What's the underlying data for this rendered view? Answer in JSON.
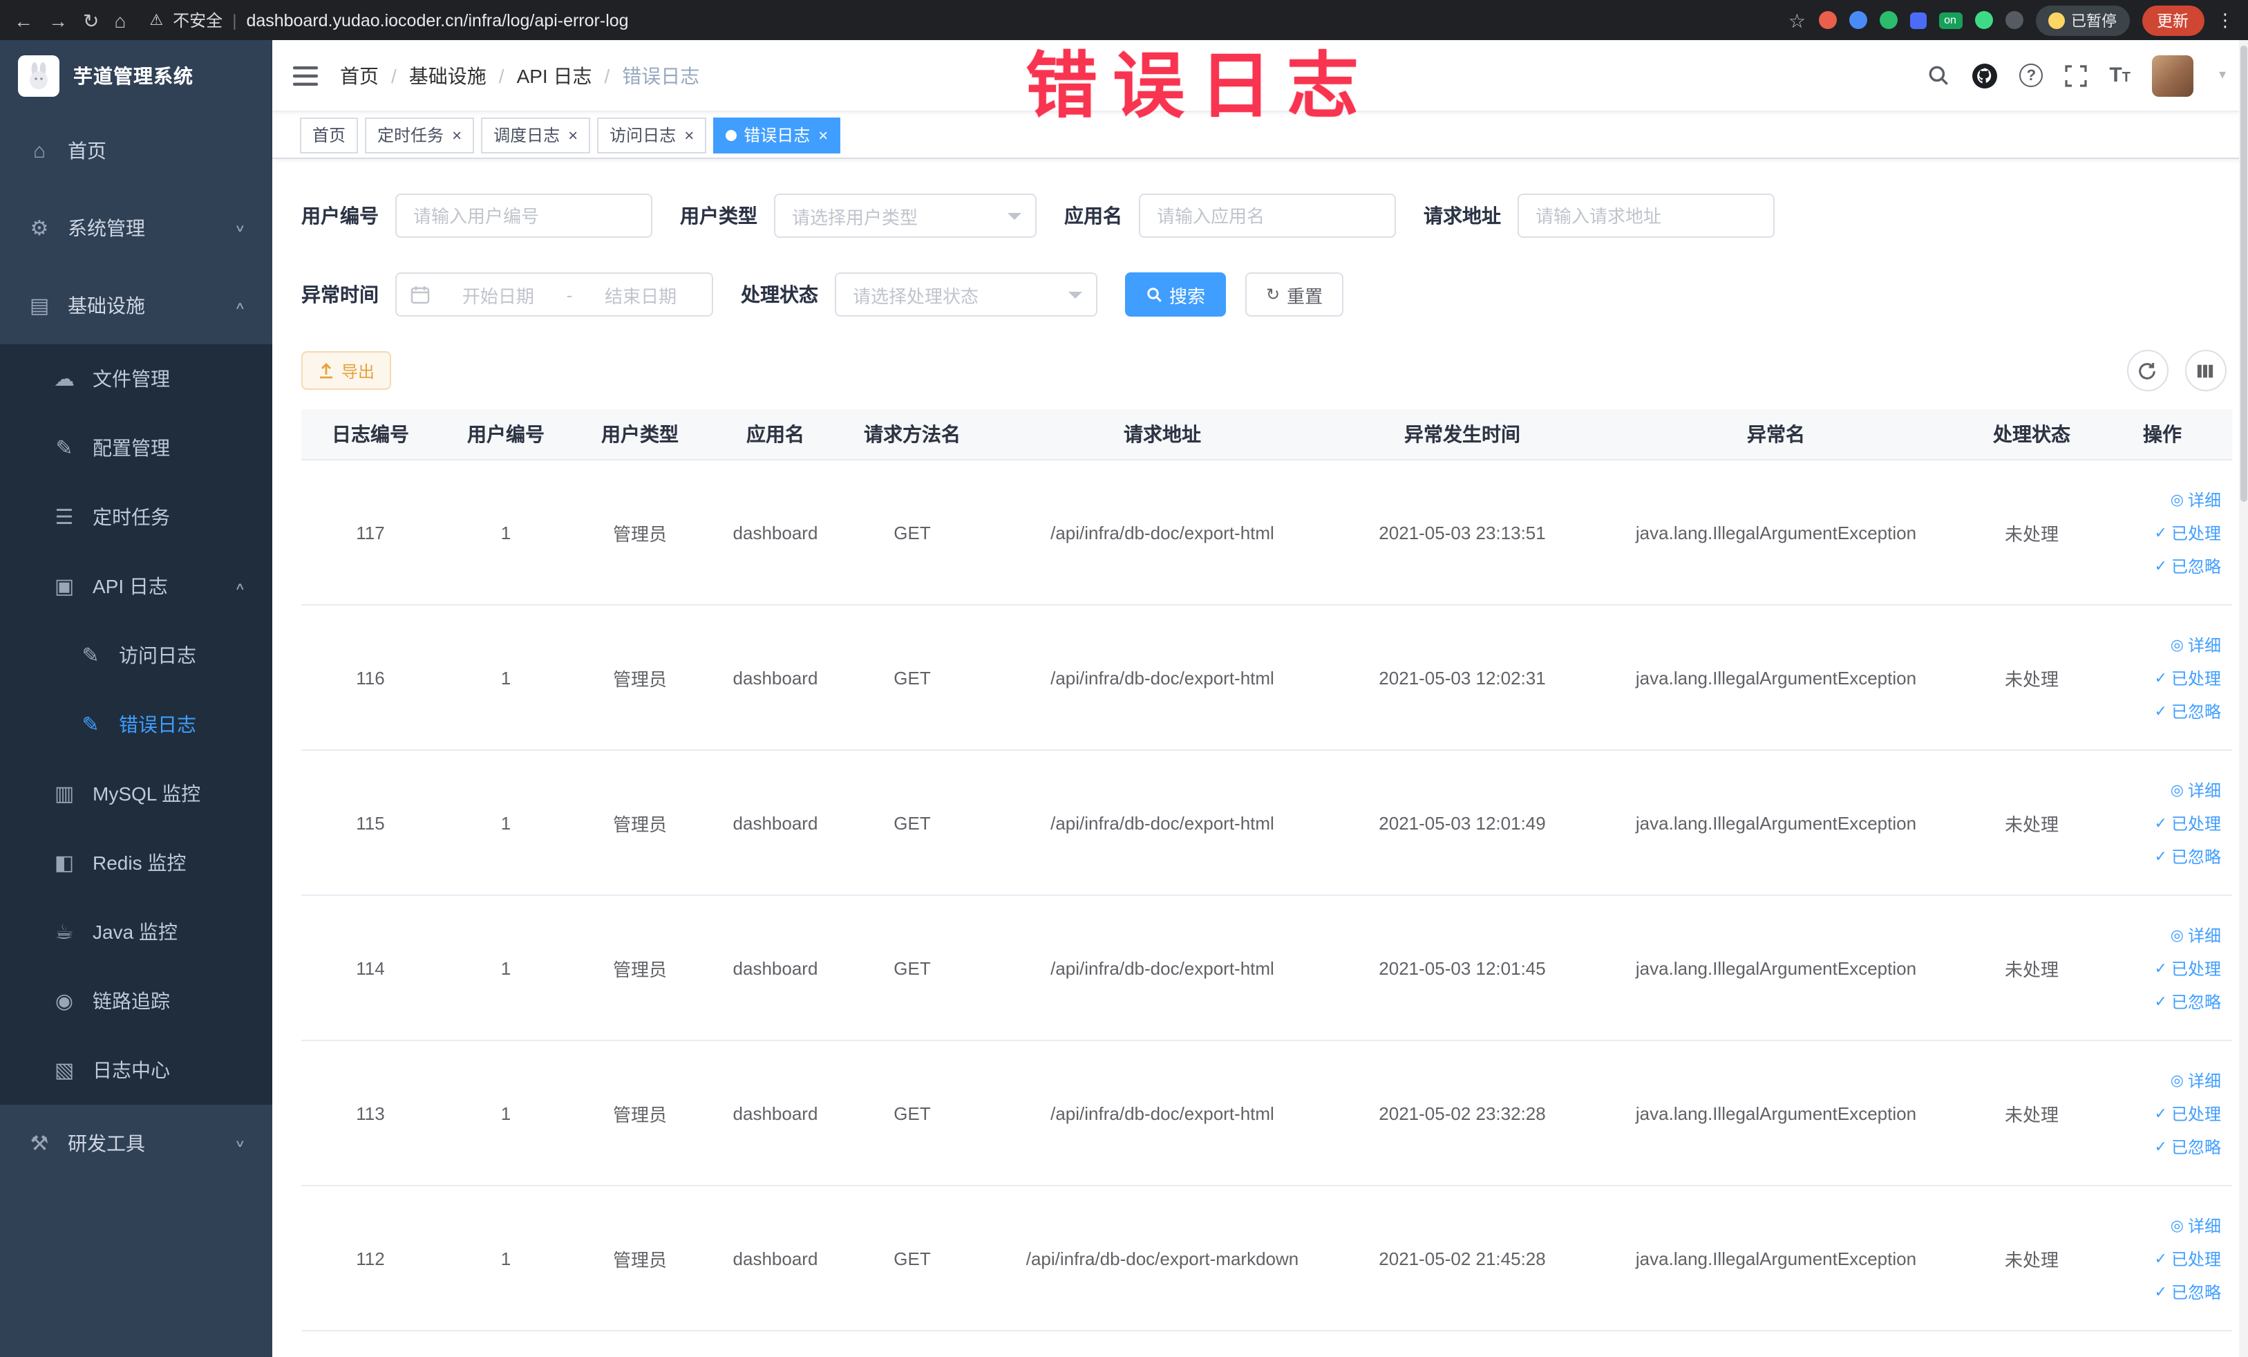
{
  "overlay": {
    "title": "错误日志"
  },
  "browser": {
    "security_label": "不安全",
    "url": "dashboard.yudao.iocoder.cn/infra/log/api-error-log",
    "paused_label": "已暂停",
    "update_label": "更新"
  },
  "icons": {
    "back": "←",
    "forward": "→",
    "reload": "↻",
    "home": "⌂",
    "star": "☆",
    "warning": "⚠",
    "more": "⋮",
    "close": "×",
    "slash": "/",
    "detail": "◎",
    "check": "✓",
    "caret": "▾",
    "reset": "↻"
  },
  "sidebar": {
    "app_title": "芋道管理系统",
    "items": [
      {
        "label": "首页",
        "glyph": "⌂"
      },
      {
        "label": "系统管理",
        "glyph": "⚙",
        "chevron": "∨"
      },
      {
        "label": "基础设施",
        "glyph": "▤",
        "chevron": "∧"
      },
      {
        "label": "文件管理",
        "glyph": "☁"
      },
      {
        "label": "配置管理",
        "glyph": "✎"
      },
      {
        "label": "定时任务",
        "glyph": "☰"
      },
      {
        "label": "API 日志",
        "glyph": "▣",
        "chevron": "∧"
      },
      {
        "label": "访问日志",
        "glyph": "✎"
      },
      {
        "label": "错误日志",
        "glyph": "✎"
      },
      {
        "label": "MySQL 监控",
        "glyph": "▥"
      },
      {
        "label": "Redis 监控",
        "glyph": "◧"
      },
      {
        "label": "Java 监控",
        "glyph": "☕"
      },
      {
        "label": "链路追踪",
        "glyph": "◉"
      },
      {
        "label": "日志中心",
        "glyph": "▧"
      },
      {
        "label": "研发工具",
        "glyph": "⚒",
        "chevron": "∨"
      }
    ]
  },
  "breadcrumb": [
    "首页",
    "基础设施",
    "API 日志",
    "错误日志"
  ],
  "tabs": [
    {
      "label": "首页"
    },
    {
      "label": "定时任务"
    },
    {
      "label": "调度日志"
    },
    {
      "label": "访问日志"
    },
    {
      "label": "错误日志"
    }
  ],
  "filters": {
    "user_id": {
      "label": "用户编号",
      "placeholder": "请输入用户编号"
    },
    "user_type": {
      "label": "用户类型",
      "placeholder": "请选择用户类型"
    },
    "app_name": {
      "label": "应用名",
      "placeholder": "请输入应用名"
    },
    "request_url": {
      "label": "请求地址",
      "placeholder": "请输入请求地址"
    },
    "exception_time": {
      "label": "异常时间",
      "start_placeholder": "开始日期",
      "separator": "-",
      "end_placeholder": "结束日期"
    },
    "process_status": {
      "label": "处理状态",
      "placeholder": "请选择处理状态"
    },
    "search_label": "搜索",
    "reset_label": "重置"
  },
  "toolbar": {
    "export_label": "导出"
  },
  "table": {
    "columns": [
      "日志编号",
      "用户编号",
      "用户类型",
      "应用名",
      "请求方法名",
      "请求地址",
      "异常发生时间",
      "异常名",
      "处理状态",
      "操作"
    ],
    "actions": {
      "detail": "详细",
      "processed": "已处理",
      "ignored": "已忽略"
    },
    "rows": [
      {
        "id": "117",
        "user_id": "1",
        "user_type": "管理员",
        "app": "dashboard",
        "method": "GET",
        "url": "/api/infra/db-doc/export-html",
        "time": "2021-05-03 23:13:51",
        "exception": "java.lang.IllegalArgumentException",
        "status": "未处理"
      },
      {
        "id": "116",
        "user_id": "1",
        "user_type": "管理员",
        "app": "dashboard",
        "method": "GET",
        "url": "/api/infra/db-doc/export-html",
        "time": "2021-05-03 12:02:31",
        "exception": "java.lang.IllegalArgumentException",
        "status": "未处理"
      },
      {
        "id": "115",
        "user_id": "1",
        "user_type": "管理员",
        "app": "dashboard",
        "method": "GET",
        "url": "/api/infra/db-doc/export-html",
        "time": "2021-05-03 12:01:49",
        "exception": "java.lang.IllegalArgumentException",
        "status": "未处理"
      },
      {
        "id": "114",
        "user_id": "1",
        "user_type": "管理员",
        "app": "dashboard",
        "method": "GET",
        "url": "/api/infra/db-doc/export-html",
        "time": "2021-05-03 12:01:45",
        "exception": "java.lang.IllegalArgumentException",
        "status": "未处理"
      },
      {
        "id": "113",
        "user_id": "1",
        "user_type": "管理员",
        "app": "dashboard",
        "method": "GET",
        "url": "/api/infra/db-doc/export-html",
        "time": "2021-05-02 23:32:28",
        "exception": "java.lang.IllegalArgumentException",
        "status": "未处理"
      },
      {
        "id": "112",
        "user_id": "1",
        "user_type": "管理员",
        "app": "dashboard",
        "method": "GET",
        "url": "/api/infra/db-doc/export-markdown",
        "time": "2021-05-02 21:45:28",
        "exception": "java.lang.IllegalArgumentException",
        "status": "未处理"
      }
    ]
  }
}
